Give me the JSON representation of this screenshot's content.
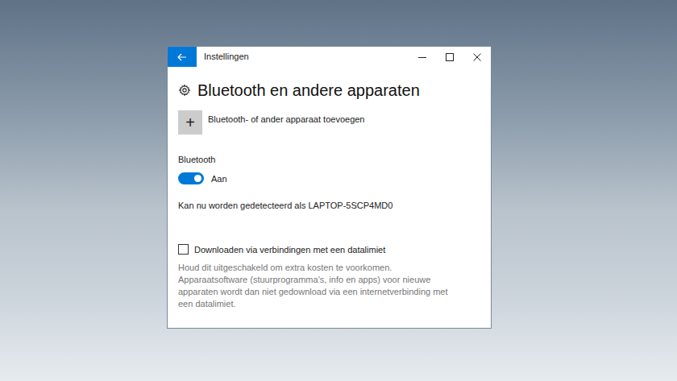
{
  "window": {
    "title": "Instellingen"
  },
  "page": {
    "heading": "Bluetooth en andere apparaten"
  },
  "add_device": {
    "label": "Bluetooth- of ander apparaat toevoegen",
    "icon": "+"
  },
  "bluetooth": {
    "label": "Bluetooth",
    "on": true,
    "state_text": "Aan",
    "discoverable_text": "Kan nu worden gedetecteerd als LAPTOP-5SCP4MD0"
  },
  "metered_download": {
    "label": "Downloaden via verbindingen met een datalimiet",
    "checked": false,
    "description": "Houd dit uitgeschakeld om extra kosten te voorkomen. Apparaatsoftware (stuurprogramma's, info en apps) voor nieuwe apparaten wordt dan niet gedownload via een internetverbinding met een datalimiet."
  }
}
